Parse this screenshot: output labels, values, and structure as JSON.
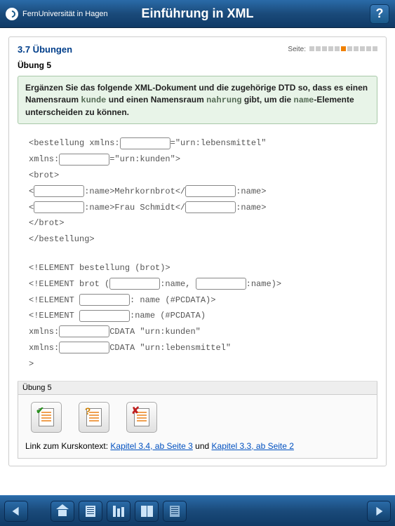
{
  "header": {
    "org": "FernUniversität in Hagen",
    "title": "Einführung in XML"
  },
  "section": {
    "number_title": "3.7 Übungen",
    "page_label": "Seite:",
    "active_page_index": 5,
    "total_pages": 11,
    "subtitle": "Übung 5"
  },
  "instruction": {
    "part1": "Ergänzen Sie das folgende XML-Dokument und die zugehörige DTD so, dass es einen Namensraum ",
    "code1": "kunde",
    "part2": " und einen Namensraum ",
    "code2": "nahrung",
    "part3": " gibt, um die ",
    "code3": "name",
    "part4": "-Elemente unterscheiden zu können."
  },
  "code": {
    "l1a": "<bestellung xmlns:",
    "l1b": "=\"urn:lebensmittel\"",
    "l2a": "  xmlns:",
    "l2b": "=\"urn:kunden\">",
    "l3": "  <brot>",
    "l4a": "    <",
    "l4b": ":name>Mehrkornbrot</",
    "l4c": ":name>",
    "l5a": "    <",
    "l5b": ":name>Frau Schmidt</",
    "l5c": ":name>",
    "l6": "  </brot>",
    "l7": "</bestellung>",
    "l8": "<!ELEMENT bestellung (brot)>",
    "l9a": "<!ELEMENT brot (",
    "l9b": ":name, ",
    "l9c": ":name)>",
    "l10a": "<!ELEMENT ",
    "l10b": ": name (#PCDATA)>",
    "l11a": "<!ELEMENT ",
    "l11b": ":name (#PCDATA)",
    "l12a": "  xmlns:",
    "l12b": "CDATA \"urn:kunden\"",
    "l13a": "  xmlns:",
    "l13b": "CDATA \"urn:lebensmittel\"",
    "l14": ">"
  },
  "footer": {
    "heading": "Übung 5",
    "context_prefix": "Link zum Kurskontext: ",
    "link1": "Kapitel 3.4, ab Seite 3",
    "und": " und ",
    "link2": "Kapitel 3.3, ab Seite 2"
  }
}
